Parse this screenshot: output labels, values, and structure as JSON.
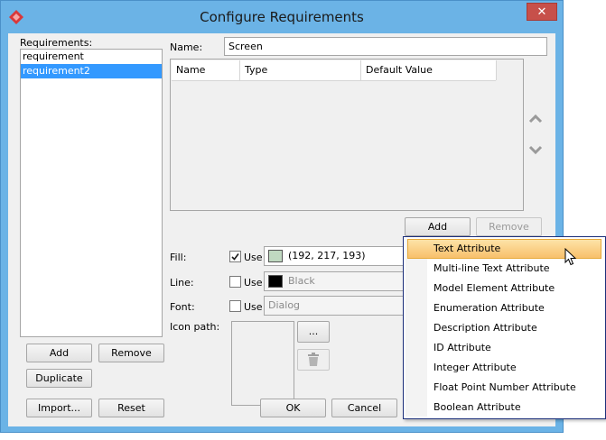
{
  "window": {
    "title": "Configure Requirements",
    "close_glyph": "✕"
  },
  "left_panel": {
    "label": "Requirements:",
    "items": [
      "requirement",
      "requirement2"
    ],
    "selected_index": 1,
    "buttons": {
      "add": "Add",
      "remove": "Remove",
      "duplicate": "Duplicate",
      "import": "Import...",
      "reset": "Reset"
    }
  },
  "form": {
    "name_label": "Name:",
    "name_value": "Screen",
    "table_columns": [
      "Name",
      "Type",
      "Default Value"
    ],
    "add_button": "Add",
    "remove_button": "Remove",
    "fill": {
      "label": "Fill:",
      "use_label": "Use",
      "checked": true,
      "value": "(192, 217, 193)",
      "color": "#c0d9c1"
    },
    "line": {
      "label": "Line:",
      "use_label": "Use",
      "checked": false,
      "value": "Black",
      "color": "#000000"
    },
    "font": {
      "label": "Font:",
      "use_label": "Use",
      "checked": false,
      "value": "Dialog"
    },
    "icon_path": {
      "label": "Icon path:",
      "browse_label": "..."
    },
    "ok_button": "OK",
    "cancel_button": "Cancel"
  },
  "dropdown_menu": {
    "items": [
      "Text Attribute",
      "Multi-line Text Attribute",
      "Model Element Attribute",
      "Enumeration Attribute",
      "Description Attribute",
      "ID Attribute",
      "Integer Attribute",
      "Float Point Number Attribute",
      "Boolean Attribute"
    ],
    "hover_index": 0
  },
  "icons": {
    "app": "diamond-logo-icon",
    "up": "chevron-up-icon",
    "down": "chevron-down-icon",
    "trash": "trash-icon",
    "check": "checkmark-icon",
    "cursor": "mouse-pointer-icon"
  },
  "colors": {
    "title_bar": "#6bb3e6",
    "selection": "#3399ff",
    "menu_hover": "#f8c06b",
    "close_button": "#c7504a"
  }
}
